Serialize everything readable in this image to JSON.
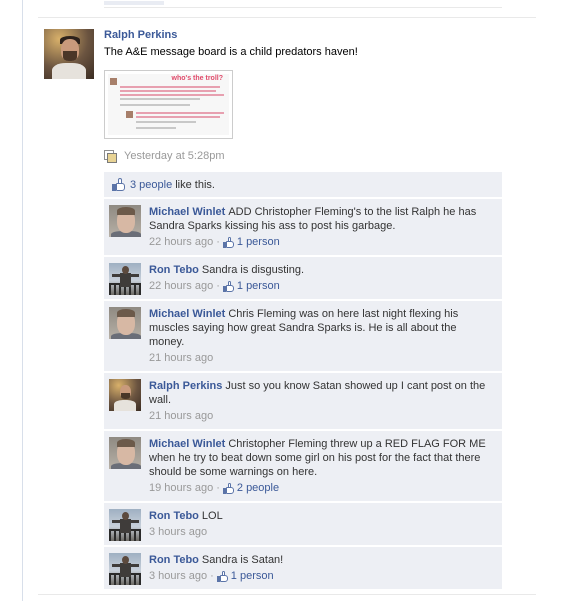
{
  "post": {
    "author": "Ralph Perkins",
    "text": "The A&E message board is a child predators haven!",
    "attachment_title": "who's the troll?",
    "timestamp": "Yesterday at 5:28pm",
    "likes": {
      "count_link": "3 people",
      "suffix": "like this."
    }
  },
  "comments": [
    {
      "author": "Michael Winlet",
      "avatar": "michael",
      "text": "ADD Christopher Fleming's to the list Ralph he has Sandra Sparks kissing his ass to post his garbage.",
      "time": "22 hours ago",
      "likes": "1 person"
    },
    {
      "author": "Ron Tebo",
      "avatar": "ron",
      "text": "Sandra is disgusting.",
      "time": "22 hours ago",
      "likes": "1 person"
    },
    {
      "author": "Michael Winlet",
      "avatar": "michael",
      "text": "Chris Fleming was on here last night flexing his muscles saying how great Sandra Sparks is. He is all about the money.",
      "time": "21 hours ago",
      "likes": ""
    },
    {
      "author": "Ralph Perkins",
      "avatar": "ralph",
      "text": "Just so you know Satan showed up I cant post on the wall.",
      "time": "21 hours ago",
      "likes": ""
    },
    {
      "author": "Michael Winlet",
      "avatar": "michael",
      "text": "Christopher Fleming threw up a RED FLAG FOR ME when he try to beat down some girl on his post for the fact that there should be some warnings on here.",
      "time": "19 hours ago",
      "likes": "2 people"
    },
    {
      "author": "Ron Tebo",
      "avatar": "ron",
      "text": "LOL",
      "time": "3 hours ago",
      "likes": ""
    },
    {
      "author": "Ron Tebo",
      "avatar": "ron",
      "text": "Sandra is Satan!",
      "time": "3 hours ago",
      "likes": "1 person"
    }
  ],
  "colors": {
    "link": "#3b5998",
    "muted": "#999999",
    "comment_bg": "#edeff4"
  }
}
